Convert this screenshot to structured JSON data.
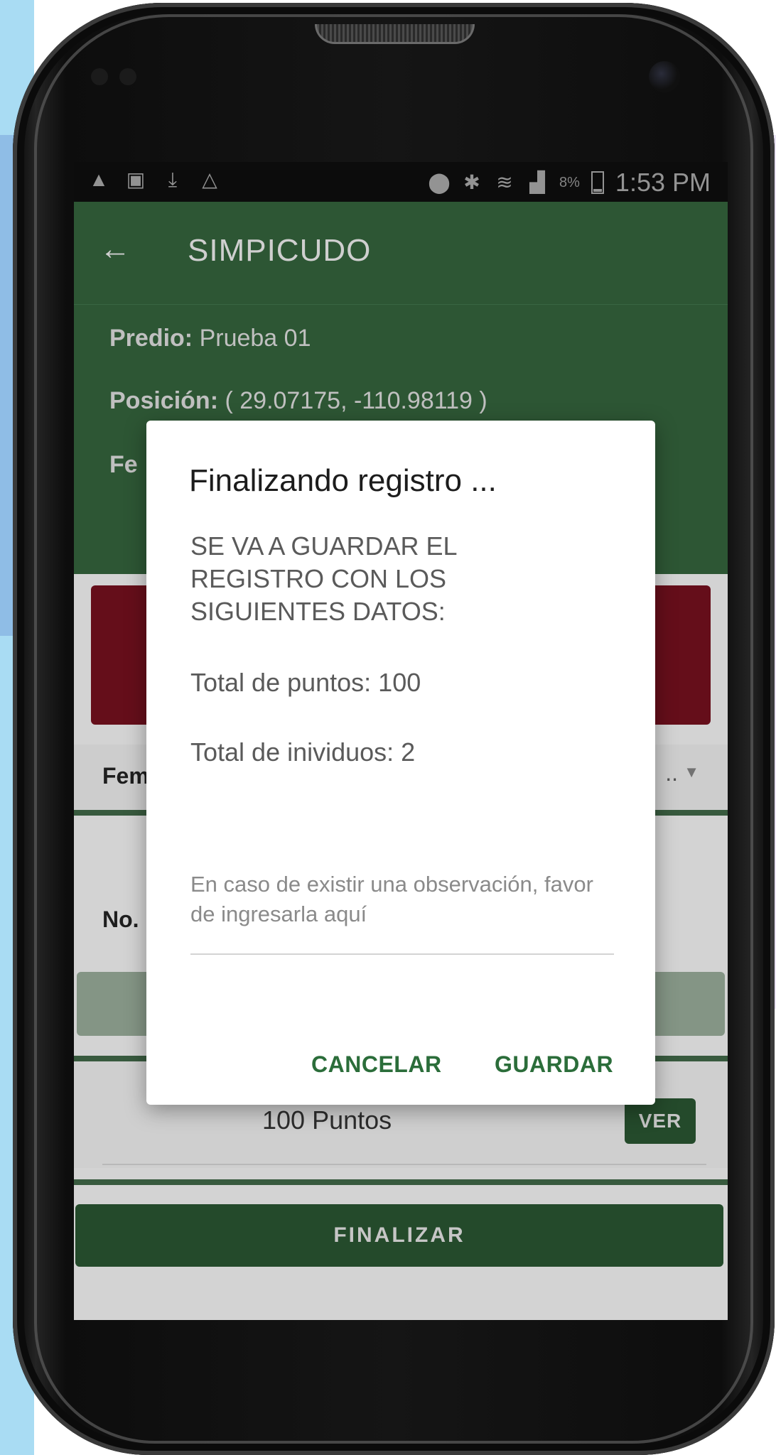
{
  "statusbar": {
    "icons": [
      "warning-icon",
      "image-icon",
      "download-icon",
      "drive-icon"
    ],
    "battery_pct": "8%",
    "time": "1:53 PM"
  },
  "appbar": {
    "back_icon": "arrow-back-icon",
    "title": "SIMPICUDO"
  },
  "info": {
    "predio_label": "Predio:",
    "predio_value": "Prueba 01",
    "posicion_label": "Posición:",
    "posicion_value": "( 29.07175, -110.98119 )",
    "fecha_label": "Fe"
  },
  "form": {
    "fem_label": "Fem",
    "fem_value": "..",
    "no_label": "No.",
    "puntos_text": "100 Puntos",
    "ver_label": "VER",
    "finalizar_label": "FINALIZAR"
  },
  "dialog": {
    "title": "Finalizando registro ...",
    "message_line1": "SE VA A GUARDAR EL",
    "message_line2": "REGISTRO CON LOS",
    "message_line3": "SIGUIENTES DATOS:",
    "total_puntos": "Total de puntos: 100",
    "total_individuos": "Total de inividuos: 2",
    "observation_placeholder": "En caso de existir una observación, favor de ingresarla aquí",
    "cancel_label": "CANCELAR",
    "save_label": "GUARDAR"
  },
  "colors": {
    "primary_green": "#2f5a37",
    "accent_green": "#2b6d3a",
    "alert_red": "#6a0f1c"
  }
}
